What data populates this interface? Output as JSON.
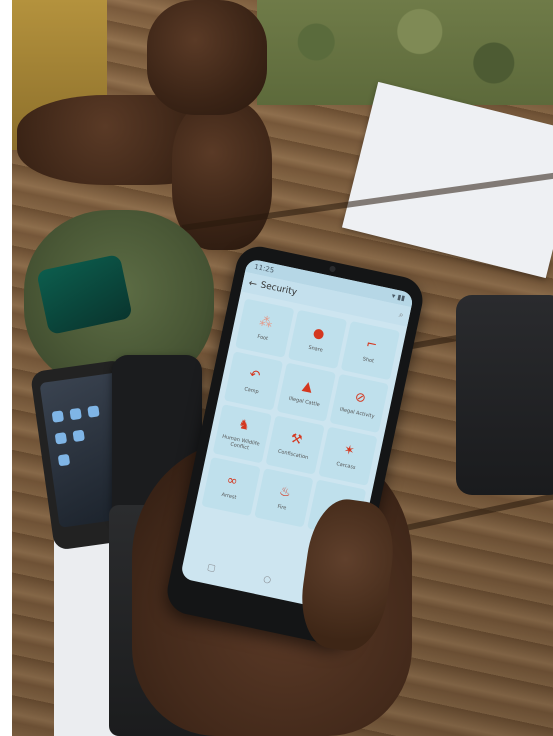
{
  "phone": {
    "status_time": "11:25",
    "screen_title": "Security",
    "tiles": [
      {
        "label": "Foot",
        "icon": "footprints-icon",
        "faded": true
      },
      {
        "label": "Snare",
        "icon": "dot-icon",
        "faded": false
      },
      {
        "label": "Shot",
        "icon": "gun-icon",
        "faded": false
      },
      {
        "label": "Camp",
        "icon": "hook-icon",
        "faded": false
      },
      {
        "label": "Illegal Cattle",
        "icon": "tent-icon",
        "faded": false
      },
      {
        "label": "Illegal Activity",
        "icon": "no-entry-icon",
        "faded": false
      },
      {
        "label": "Human Wildlife Conflict",
        "icon": "cattle-icon",
        "faded": false
      },
      {
        "label": "Confiscation",
        "icon": "axe-icon",
        "faded": false
      },
      {
        "label": "Carcass",
        "icon": "carcass-icon",
        "faded": false
      },
      {
        "label": "Arrest",
        "icon": "handcuffs-icon",
        "faded": false
      },
      {
        "label": "Fire",
        "icon": "fire-icon",
        "faded": false
      },
      {
        "label": "",
        "icon": "",
        "faded": false
      }
    ],
    "accent_color": "#d4371f"
  }
}
